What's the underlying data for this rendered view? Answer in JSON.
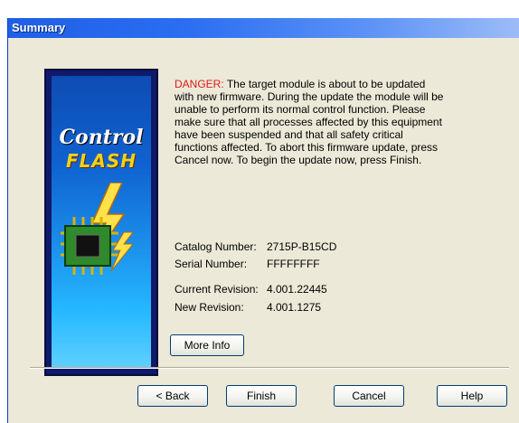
{
  "window": {
    "title": "Summary"
  },
  "logo": {
    "word_1": "Control",
    "word_2": "FLASH"
  },
  "message": {
    "danger_label": "DANGER:",
    "body": "The target module is about to be updated with new firmware. During the update the module will be unable to perform its normal control function. Please make sure that all processes affected by this equipment have been suspended and that all safety critical functions affected. To abort this firmware update, press Cancel now. To begin the update now, press Finish."
  },
  "details": {
    "catalog_label": "Catalog Number:",
    "catalog_value": "2715P-B15CD",
    "serial_label": "Serial Number:",
    "serial_value": "FFFFFFFF",
    "current_rev_label": "Current Revision:",
    "current_rev_value": "4.001.22445",
    "new_rev_label": "New Revision:",
    "new_rev_value": "4.001.1275"
  },
  "buttons": {
    "more_info": "More Info",
    "back": "< Back",
    "finish": "Finish",
    "cancel": "Cancel",
    "help": "Help"
  },
  "colors": {
    "danger": "#e01818",
    "titlebar": "#2b6ef2",
    "dialog_bg": "#ece9d8"
  }
}
